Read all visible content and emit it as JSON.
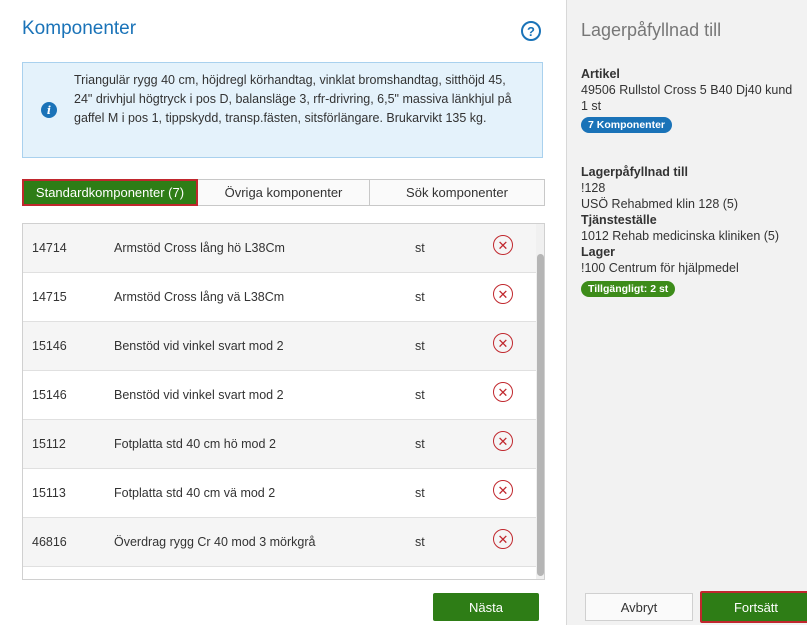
{
  "components_panel": {
    "title": "Komponenter",
    "help_icon": "?",
    "info": {
      "icon": "i",
      "text": "Triangulär rygg 40 cm, höjdregl körhandtag, vinklat bromshandtag, sitthöjd 45, 24\" drivhjul högtryck i pos D, balansläge 3, rfr-drivring, 6,5\" massiva länkhjul på gaffel M i pos 1, tippskydd, transp.fästen, sitsförlängare. Brukarvikt 135 kg."
    },
    "tabs": [
      {
        "label": "Standardkomponenter (7)",
        "active": true
      },
      {
        "label": "Övriga komponenter",
        "active": false
      },
      {
        "label": "Sök komponenter",
        "active": false
      }
    ],
    "rows": [
      {
        "id": "14714",
        "name": "Armstöd Cross lång hö L38Cm",
        "unit": "st"
      },
      {
        "id": "14715",
        "name": "Armstöd Cross lång vä L38Cm",
        "unit": "st"
      },
      {
        "id": "15146",
        "name": "Benstöd vid vinkel svart mod 2",
        "unit": "st"
      },
      {
        "id": "15146",
        "name": "Benstöd vid vinkel svart mod 2",
        "unit": "st"
      },
      {
        "id": "15112",
        "name": "Fotplatta std 40 cm hö mod 2",
        "unit": "st"
      },
      {
        "id": "15113",
        "name": "Fotplatta std 40 cm vä mod 2",
        "unit": "st"
      },
      {
        "id": "46816",
        "name": "Överdrag rygg Cr 40 mod 3 mörkgrå",
        "unit": "st"
      }
    ],
    "delete_icon": "✕",
    "next_label": "Nästa"
  },
  "refill_panel": {
    "title": "Lagerpåfyllnad till",
    "article_label": "Artikel",
    "article_value": "49506 Rullstol Cross 5 B40 Dj40 kund",
    "article_qty": "1 st",
    "components_badge": "7 Komponenter",
    "refill_label": "Lagerpåfyllnad till",
    "refill_code": "!128",
    "refill_name": "USÖ Rehabmed klin 128 (5)",
    "service_label": "Tjänsteställe",
    "service_value": "1012 Rehab medicinska kliniken (5)",
    "stock_label": "Lager",
    "stock_value": "!100 Centrum för hjälpmedel",
    "available_badge": "Tillgängligt: 2 st",
    "cancel_label": "Avbryt",
    "continue_label": "Fortsätt"
  },
  "colors": {
    "primary_blue": "#1a73b8",
    "action_green": "#2e7d16",
    "highlight_red": "#c0272d"
  }
}
